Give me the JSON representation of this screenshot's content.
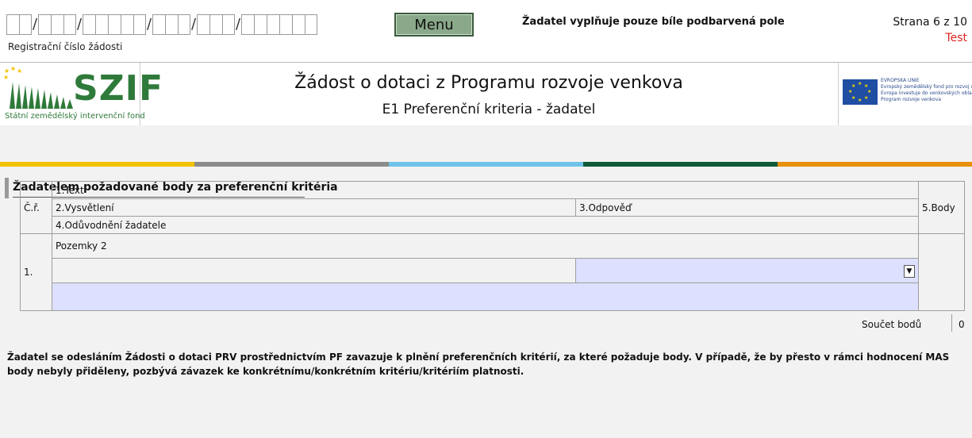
{
  "header": {
    "reg_label": "Registrační číslo žádosti",
    "menu_label": "Menu",
    "notice": "Žadatel vyplňuje pouze bíle podbarvená pole",
    "page_label": "Strana 6 z 10",
    "env_label": "Test"
  },
  "logo": {
    "szif_word": "SZIF",
    "szif_sub": "Státní zemědělský intervenční fond",
    "eu_lines": [
      "EVROPSKÁ UNIE",
      "Evropský zemědělský fond pro rozvoj venkova",
      "Evropa investuje do venkovských oblastí",
      "Program rozvoje venkova"
    ]
  },
  "titles": {
    "main": "Žádost o dotaci z Programu rozvoje venkova",
    "sub": "E1 Preferenční kriteria - žadatel"
  },
  "section": {
    "title": "Žadatelem požadované body za preferenční kritéria"
  },
  "table": {
    "col_cr": "Č.ř.",
    "col_text": "1.Text",
    "col_vysv": "2.Vysvětlení",
    "col_odp": "3.Odpověď",
    "col_oduv": "4.Odůvodnění žadatele",
    "col_body": "5.Body",
    "rows": [
      {
        "num": "1.",
        "text": "Pozemky 2",
        "vysvetleni": "",
        "odpoved": "",
        "oduvodneni": "",
        "body": ""
      }
    ]
  },
  "sum": {
    "label": "Součet bodů",
    "value": "0"
  },
  "footer": {
    "text": "Žadatel se odesláním Žádosti o dotaci PRV prostřednictvím PF zavazuje k plnění preferenčních kritérií, za které požaduje body. V případě, že by přesto v rámci hodnocení MAS body nebyly přiděleny, pozbývá závazek ke konkrétnímu/konkrétním kritériu/kritériím platnosti."
  },
  "colors": {
    "stripe": [
      "#f2c200",
      "#8c8c8c",
      "#6fc3e8",
      "#0f5a3a",
      "#e8900a"
    ],
    "input_bg": "#dde0ff",
    "menu_bg": "#8aa98a",
    "test_red": "#dd2222"
  }
}
